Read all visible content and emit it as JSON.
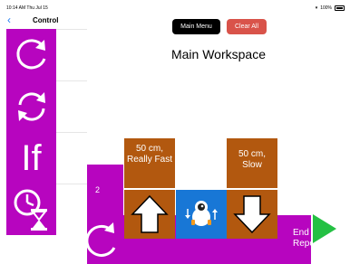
{
  "status_bar": {
    "time": "10:14 AM  Thu Jul 15",
    "battery": "100%"
  },
  "sidebar": {
    "back_icon": "chevron-left-icon",
    "title": "Control",
    "palette": [
      {
        "icon": "loop-icon"
      },
      {
        "icon": "repeat-arrows-icon"
      },
      {
        "label": "If"
      },
      {
        "icon": "clock-hourglass-icon"
      }
    ]
  },
  "toolbar": {
    "main_menu_label": "Main Menu",
    "clear_all_label": "Clear All"
  },
  "workspace": {
    "title": "Main Workspace",
    "repeat_count": "2",
    "commands": [
      {
        "label": "50 cm, Really Fast",
        "arrow": "arrow-up-icon"
      },
      {
        "label": "50 cm, Slow",
        "arrow": "arrow-down-icon"
      }
    ],
    "end_repeat_label": "End Repeat",
    "robot_icon": "robot-icon",
    "play_icon": "play-icon"
  },
  "colors": {
    "purple": "#b705bf",
    "brown": "#b2580f",
    "blue": "#1877d6",
    "green": "#24c043",
    "red": "#d9534a"
  }
}
